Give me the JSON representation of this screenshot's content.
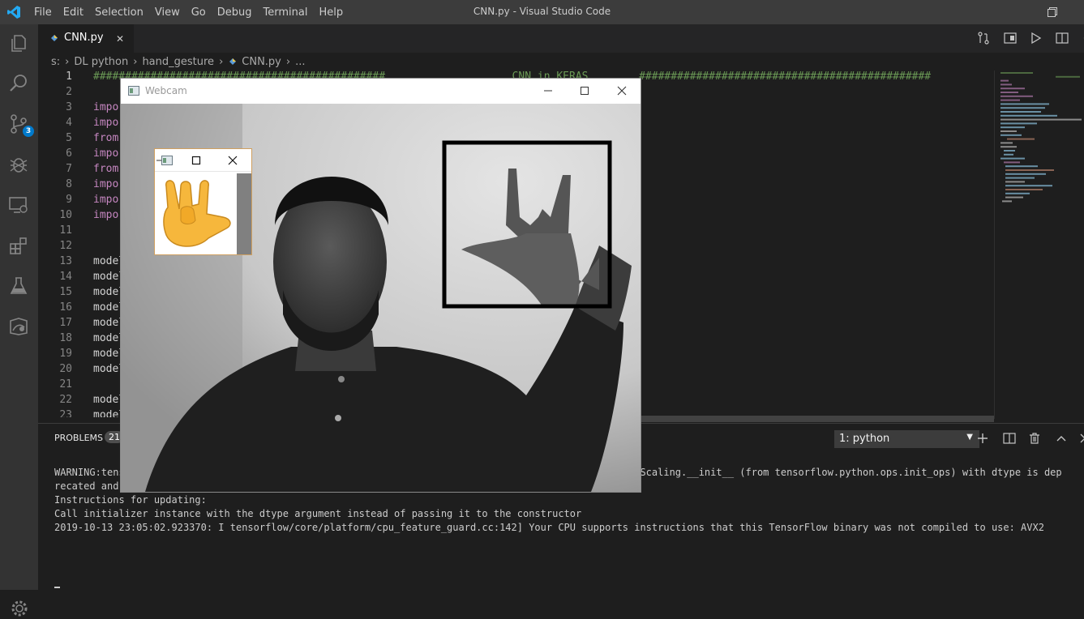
{
  "titlebar": {
    "menu": [
      "File",
      "Edit",
      "Selection",
      "View",
      "Go",
      "Debug",
      "Terminal",
      "Help"
    ],
    "title": "CNN.py - Visual Studio Code"
  },
  "activity_bar": {
    "items": [
      "explorer-icon",
      "search-icon",
      "source-control-icon",
      "debug-icon",
      "remote-explorer-icon",
      "extensions-icon",
      "testing-flask-icon",
      "remote-icon"
    ],
    "source_control_badge": "3",
    "settings_icon": "gear-icon"
  },
  "tab": {
    "label": "CNN.py",
    "close": "✕"
  },
  "breadcrumb": {
    "parts": [
      "s:",
      "DL python",
      "hand_gesture",
      "CNN.py",
      "..."
    ]
  },
  "editor": {
    "line_numbers": [
      "1",
      "2",
      "3",
      "4",
      "5",
      "6",
      "7",
      "8",
      "9",
      "10",
      "11",
      "12",
      "13",
      "14",
      "15",
      "16",
      "17",
      "18",
      "19",
      "20",
      "21",
      "22",
      "23"
    ],
    "lines": [
      {
        "type": "comment",
        "text": "##############################################                    CNN in KERAS        ##############################################"
      },
      {
        "type": "blank",
        "text": ""
      },
      {
        "type": "kw",
        "text": "impor"
      },
      {
        "type": "kw",
        "text": "impor"
      },
      {
        "type": "kw",
        "text": "from "
      },
      {
        "type": "kw",
        "text": "impor"
      },
      {
        "type": "kw",
        "text": "from "
      },
      {
        "type": "kw",
        "text": "impor"
      },
      {
        "type": "kw",
        "text": "impor"
      },
      {
        "type": "kw",
        "text": "impor"
      },
      {
        "type": "blank",
        "text": ""
      },
      {
        "type": "blank",
        "text": ""
      },
      {
        "type": "id",
        "text": "model"
      },
      {
        "type": "id",
        "text": "model"
      },
      {
        "type": "id",
        "text": "model"
      },
      {
        "type": "id",
        "text": "model"
      },
      {
        "type": "id",
        "text": "model"
      },
      {
        "type": "id",
        "text": "model"
      },
      {
        "type": "id",
        "text": "model"
      },
      {
        "type": "id",
        "text": "model"
      },
      {
        "type": "blank",
        "text": ""
      },
      {
        "type": "id",
        "text": "model"
      },
      {
        "type": "id",
        "text": "model"
      }
    ]
  },
  "panel": {
    "tab_label": "PROBLEMS",
    "problem_count": "21",
    "terminal_select": "1: python",
    "terminal_lines": [
      "WARNING:tens                                                                                 arianceScaling.__init__ (from tensorflow.python.ops.init_ops) with dtype is dep",
      "recated and ",
      "Instructions for updating:",
      "Call initializer instance with the dtype argument instead of passing it to the constructor",
      "2019-10-13 23:05:02.923370: I tensorflow/core/platform/cpu_feature_guard.cc:142] Your CPU supports instructions that this TensorFlow binary was not compiled to use: AVX2"
    ]
  },
  "webcam_window": {
    "title": "Webcam",
    "controls": [
      "minimize-icon",
      "maximize-icon",
      "close-icon"
    ]
  },
  "colors": {
    "accent": "#007acc",
    "keyword": "#c586c0",
    "comment": "#6a9955"
  }
}
